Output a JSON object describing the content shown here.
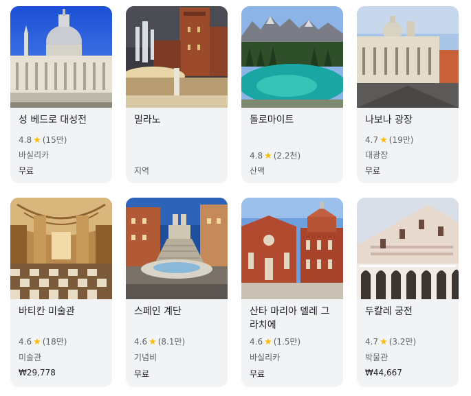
{
  "places": [
    {
      "title": "성 베드로 대성전",
      "rating": "4.8",
      "count": "(15만)",
      "category": "바실리카",
      "price": "무료",
      "image": "st-peters-basilica-photo"
    },
    {
      "title": "밀라노",
      "rating": "",
      "count": "",
      "category": "지역",
      "price": "",
      "image": "milan-castle-fountain-photo"
    },
    {
      "title": "돌로마이트",
      "rating": "4.8",
      "count": "(2.2천)",
      "category": "산맥",
      "price": "",
      "image": "dolomites-lake-photo"
    },
    {
      "title": "나보나 광장",
      "rating": "4.7",
      "count": "(19만)",
      "category": "대광장",
      "price": "무료",
      "image": "piazza-navona-photo"
    },
    {
      "title": "바티칸 미술관",
      "rating": "4.6",
      "count": "(18만)",
      "category": "미술관",
      "price": "₩29,778",
      "image": "vatican-museums-hall-photo"
    },
    {
      "title": "스페인 계단",
      "rating": "4.6",
      "count": "(8.1만)",
      "category": "기념비",
      "price": "무료",
      "image": "spanish-steps-photo"
    },
    {
      "title": "산타 마리아 델레 그라치에",
      "rating": "4.6",
      "count": "(1.5만)",
      "category": "바실리카",
      "price": "무료",
      "image": "santa-maria-delle-grazie-photo"
    },
    {
      "title": "두칼레 궁전",
      "rating": "4.7",
      "count": "(3.2만)",
      "category": "박물관",
      "price": "₩44,667",
      "image": "doges-palace-photo"
    }
  ],
  "star_glyph": "★",
  "colors": {
    "card_bg": "#f1f3f4",
    "star": "#fbbc04",
    "text": "#202124",
    "muted": "#5f6368"
  }
}
